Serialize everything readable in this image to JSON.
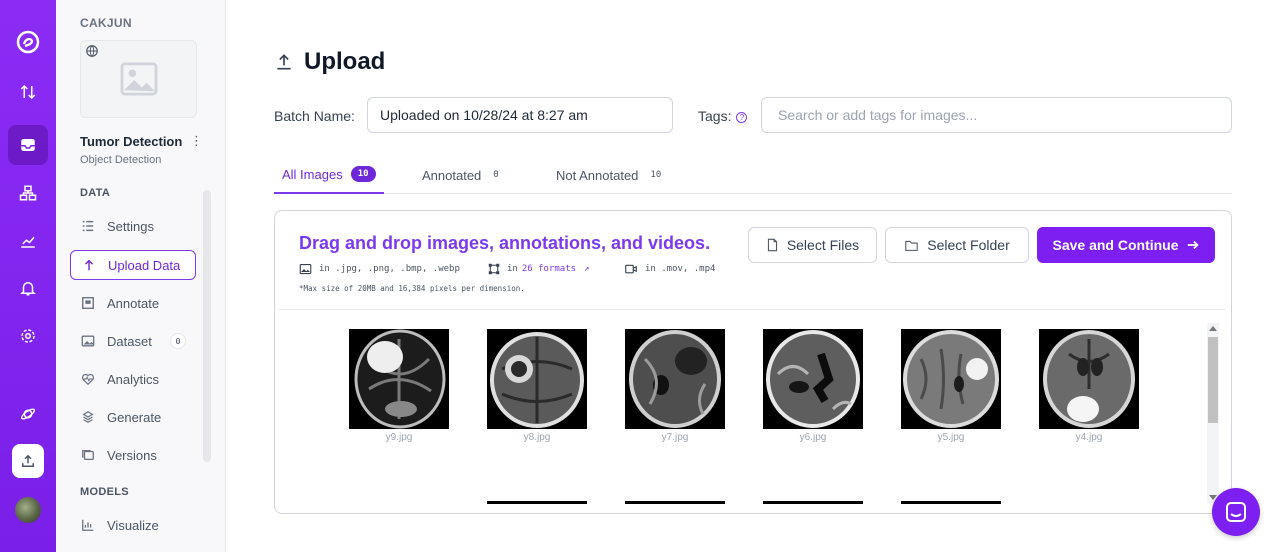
{
  "sidebar": {
    "workspace": "CAKJUN",
    "project_name": "Tumor Detection",
    "project_type": "Object Detection",
    "data_section": "DATA",
    "models_section": "MODELS",
    "items": [
      {
        "label": "Settings"
      },
      {
        "label": "Upload Data"
      },
      {
        "label": "Annotate"
      },
      {
        "label": "Dataset",
        "badge": "0"
      },
      {
        "label": "Analytics"
      },
      {
        "label": "Generate"
      },
      {
        "label": "Versions"
      },
      {
        "label": "Visualize"
      }
    ]
  },
  "page": {
    "title": "Upload",
    "batch_label": "Batch Name:",
    "batch_value": "Uploaded on 10/28/24 at 8:27 am",
    "tags_label": "Tags:",
    "tags_placeholder": "Search or add tags for images..."
  },
  "tabs": [
    {
      "label": "All Images",
      "count": "10"
    },
    {
      "label": "Annotated",
      "count": "0"
    },
    {
      "label": "Not Annotated",
      "count": "10"
    }
  ],
  "dropzone": {
    "title": "Drag and drop images, annotations, and videos.",
    "image_formats": "in .jpg, .png, .bmp, .webp",
    "annot_prefix": "in",
    "annot_link": "26 formats",
    "video_formats": "in .mov, .mp4",
    "max_note": "*Max size of 20MB and 16,384 pixels per dimension.",
    "select_files": "Select Files",
    "select_folder": "Select Folder",
    "save_continue": "Save and Continue"
  },
  "images": [
    "y9.jpg",
    "y8.jpg",
    "y7.jpg",
    "y6.jpg",
    "y5.jpg",
    "y4.jpg"
  ],
  "colors": {
    "accent": "#7c1ff0",
    "rail": "#8b2cf5"
  }
}
